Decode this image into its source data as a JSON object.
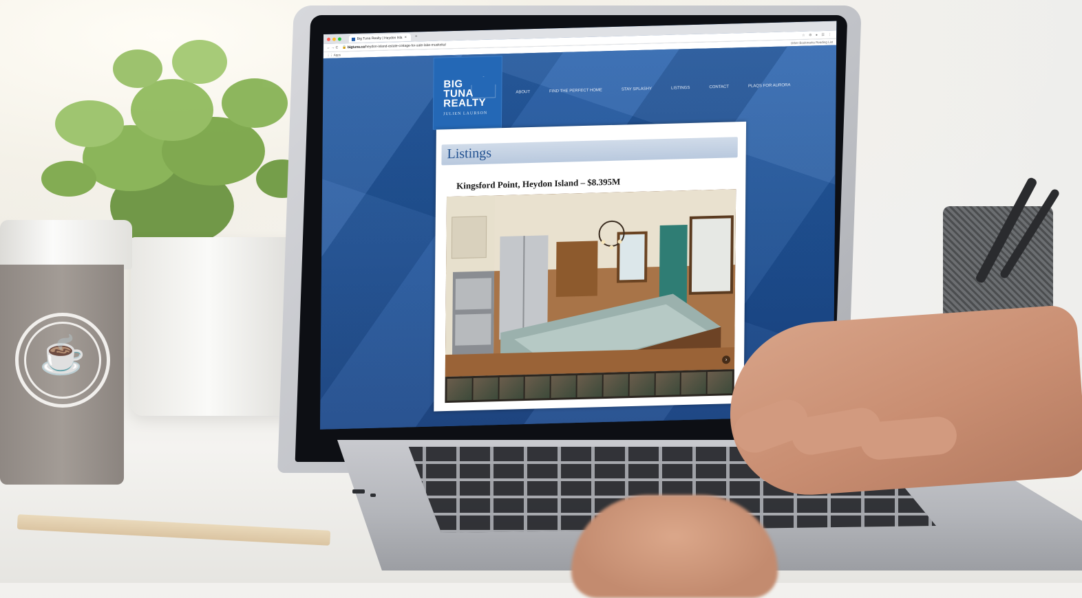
{
  "browser": {
    "tab_title": "Big Tuna Realty | Heydon Isla",
    "tab_close": "×",
    "new_tab": "+",
    "url_domain": "bigtuna.ca",
    "url_path": "/heydon-island-estate-cottage-for-sale-lake-muskoka/",
    "nav_buttons": "← → C",
    "apps_label": "Apps",
    "bookmarks_right": "Other Bookmarks   Reading List"
  },
  "site": {
    "logo": {
      "line1": "BIG",
      "line2": "TUNA",
      "line3": "REALTY",
      "agent": "JULIEN LAURSON"
    },
    "nav": [
      "ABOUT",
      "FIND THE PERFECT HOME",
      "STAY SPLASHY",
      "LISTINGS",
      "CONTACT",
      "PLAQS FOR AURORA"
    ],
    "section_title": "Listings",
    "listing_heading": "Kingsford Point, Heydon Island – $8.395M",
    "thumbnail_count": 11
  },
  "colors": {
    "site_blue": "#1f5298",
    "logo_blue": "#2468b6",
    "heading_blue": "#1f4f8f"
  }
}
